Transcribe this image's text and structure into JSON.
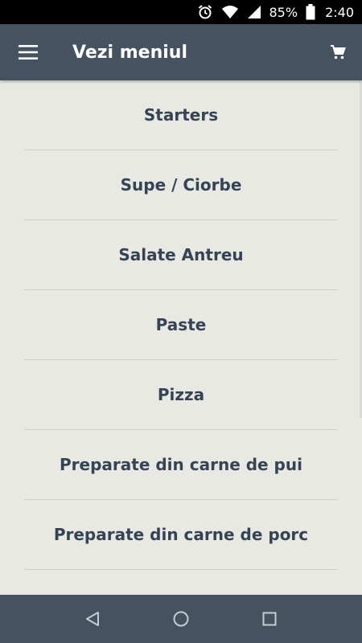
{
  "status_bar": {
    "battery": "85%",
    "time": "2:40",
    "icons": [
      "alarm-icon",
      "wifi-icon",
      "signal-icon",
      "battery-icon"
    ]
  },
  "app_bar": {
    "title": "Vezi meniul",
    "menu_icon": "hamburger-menu-icon",
    "cart_icon": "cart-icon"
  },
  "menu": {
    "items": [
      {
        "label": "Starters"
      },
      {
        "label": "Supe / Ciorbe"
      },
      {
        "label": "Salate Antreu"
      },
      {
        "label": "Paste"
      },
      {
        "label": "Pizza"
      },
      {
        "label": "Preparate din carne de pui"
      },
      {
        "label": "Preparate din carne de porc"
      }
    ]
  },
  "nav_bar": {
    "icons": [
      "back-icon",
      "home-icon",
      "recents-icon"
    ]
  },
  "colors": {
    "app_bar": "#455260",
    "background": "#e9e9e4",
    "text": "#354454",
    "divider": "#cfd0cc"
  }
}
